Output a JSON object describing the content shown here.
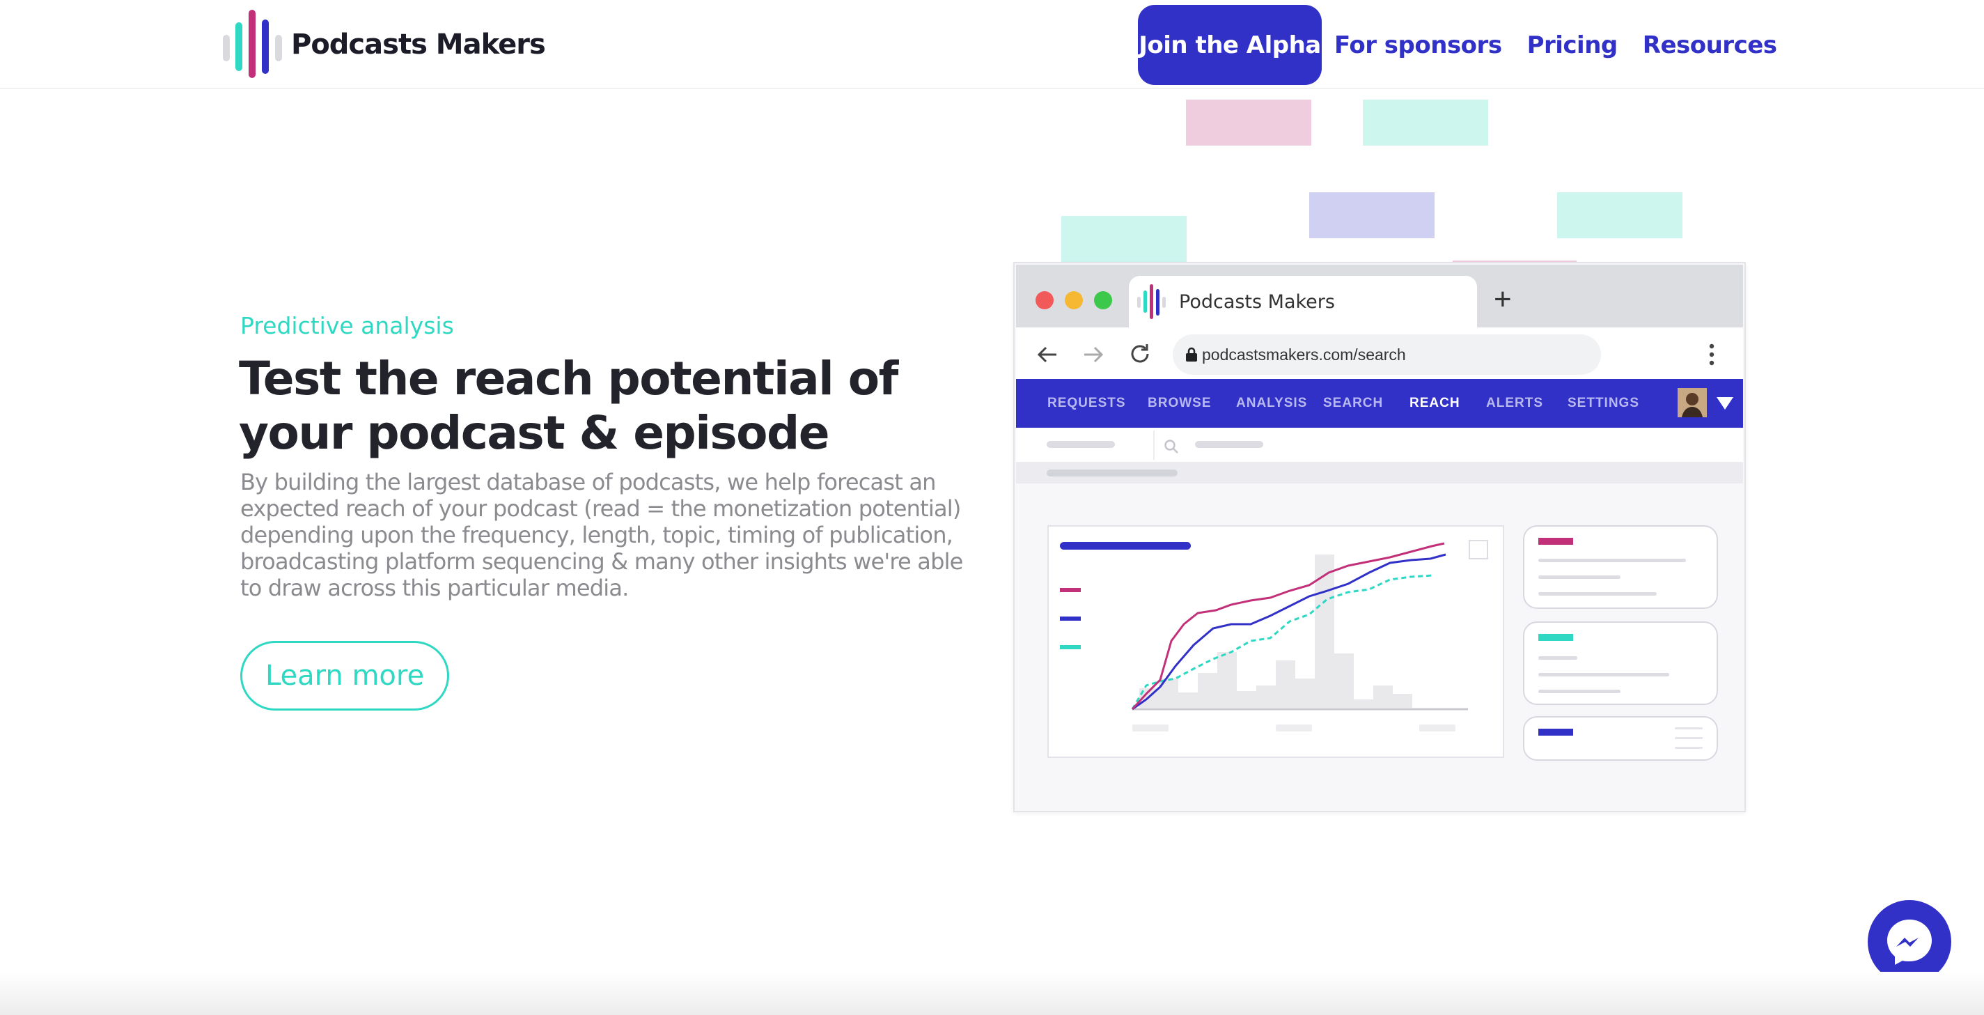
{
  "brand": {
    "name": "Podcasts Makers"
  },
  "nav": {
    "cta": "Join the Alpha",
    "links": [
      "For sponsors",
      "Pricing",
      "Resources"
    ]
  },
  "hero": {
    "eyebrow": "Predictive analysis",
    "title": "Test the reach potential of your podcast & episode",
    "description": "By building the largest database of podcasts, we help forecast an expected reach of your podcast (read = the monetization potential) depending upon the frequency, length, topic, timing of publication, broadcasting platform sequencing & many other insights we're able to draw across this particular media.",
    "cta": "Learn more"
  },
  "mockup": {
    "tab_title": "Podcasts Makers",
    "new_tab": "+",
    "url": "podcastsmakers.com/search",
    "app_nav": [
      "REQUESTS",
      "BROWSE",
      "ANALYSIS",
      "SEARCH",
      "REACH",
      "ALERTS",
      "SETTINGS"
    ],
    "active_nav": "REACH"
  },
  "colors": {
    "brand": "#3131c8",
    "teal": "#2ed8c3",
    "magenta": "#c2307a",
    "text_dark": "#23232b",
    "text_muted": "#8a8a8f"
  },
  "icons": [
    "logo-bars-icon",
    "back-arrow-icon",
    "forward-arrow-icon",
    "reload-icon",
    "lock-icon",
    "kebab-menu-icon",
    "avatar",
    "caret-down-icon",
    "search-icon",
    "messenger-icon"
  ]
}
